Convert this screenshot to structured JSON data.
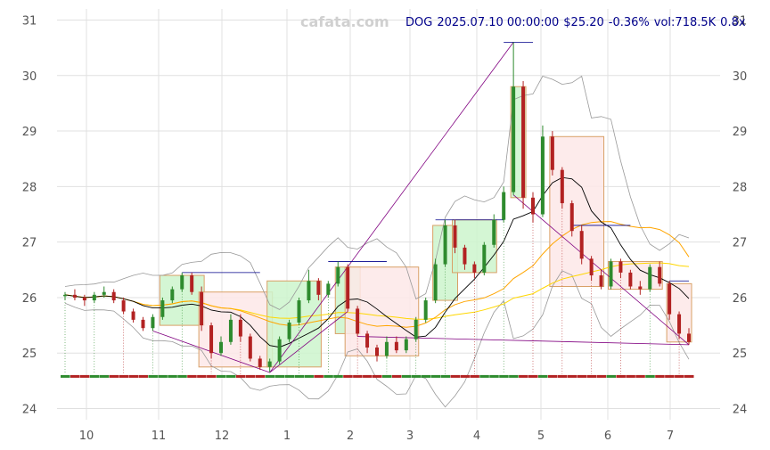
{
  "watermark": "cafata.com",
  "header": {
    "symbol": "DOG",
    "datetime": "2025.07.10 00:00:00",
    "price": "$25.20",
    "change": "-0.36%",
    "volume": "vol:718.5K",
    "ratio": "0.8x"
  },
  "colors": {
    "up": "#2e8b2e",
    "down": "#b22222",
    "up_zone_fill": "#ccf5cc",
    "down_zone_fill": "#fde8e8",
    "zone_border": "#d9a066",
    "grid": "#e0e0e0",
    "ma_short": "#000000",
    "ma_mid": "#ffa500",
    "ma_long": "#ffd700",
    "bollinger": "#999999",
    "trend": "#800080",
    "level": "#00008b"
  },
  "chart_data": {
    "type": "candlestick",
    "x_tick_labels": [
      "10",
      "11",
      "12",
      "1",
      "2",
      "3",
      "4",
      "5",
      "6",
      "7"
    ],
    "y_tick_labels": [
      "24",
      "25",
      "26",
      "27",
      "28",
      "29",
      "30",
      "31"
    ],
    "ylim": [
      23.8,
      31.2
    ],
    "grid": true,
    "series": [
      {
        "values": [
          [
            26.05,
            26.1,
            25.95,
            26.05
          ],
          [
            26.05,
            26.15,
            25.95,
            26.0
          ],
          [
            26.0,
            26.05,
            25.85,
            25.95
          ],
          [
            25.95,
            26.1,
            25.9,
            26.05
          ],
          [
            26.05,
            26.2,
            26.0,
            26.1
          ],
          [
            26.1,
            26.15,
            25.9,
            25.95
          ],
          [
            25.95,
            26.0,
            25.7,
            25.75
          ],
          [
            25.75,
            25.8,
            25.55,
            25.6
          ],
          [
            25.6,
            25.65,
            25.4,
            25.45
          ],
          [
            25.45,
            25.7,
            25.4,
            25.65
          ],
          [
            25.65,
            26.0,
            25.6,
            25.95
          ],
          [
            25.95,
            26.2,
            25.9,
            26.15
          ],
          [
            26.15,
            26.45,
            26.1,
            26.4
          ],
          [
            26.4,
            26.45,
            26.05,
            26.1
          ],
          [
            26.1,
            26.2,
            25.4,
            25.5
          ],
          [
            25.5,
            25.55,
            24.9,
            25.0
          ],
          [
            25.0,
            25.3,
            24.95,
            25.2
          ],
          [
            25.2,
            25.7,
            25.15,
            25.6
          ],
          [
            25.6,
            25.7,
            25.2,
            25.3
          ],
          [
            25.3,
            25.35,
            24.85,
            24.9
          ],
          [
            24.9,
            24.95,
            24.7,
            24.75
          ],
          [
            24.75,
            24.9,
            24.65,
            24.85
          ],
          [
            24.85,
            25.3,
            24.8,
            25.25
          ],
          [
            25.25,
            25.6,
            25.2,
            25.55
          ],
          [
            25.55,
            26.0,
            25.5,
            25.95
          ],
          [
            25.95,
            26.5,
            25.9,
            26.3
          ],
          [
            26.3,
            26.35,
            25.95,
            26.05
          ],
          [
            26.05,
            26.3,
            26.0,
            26.25
          ],
          [
            26.25,
            26.65,
            26.2,
            26.55
          ],
          [
            26.55,
            26.6,
            25.75,
            25.8
          ],
          [
            25.8,
            25.85,
            25.3,
            25.35
          ],
          [
            25.35,
            25.4,
            25.0,
            25.1
          ],
          [
            25.1,
            25.15,
            24.85,
            24.95
          ],
          [
            24.95,
            25.3,
            24.9,
            25.2
          ],
          [
            25.2,
            25.3,
            25.0,
            25.05
          ],
          [
            25.05,
            25.3,
            25.0,
            25.25
          ],
          [
            25.25,
            25.65,
            25.2,
            25.6
          ],
          [
            25.6,
            26.0,
            25.55,
            25.95
          ],
          [
            25.95,
            26.7,
            25.9,
            26.6
          ],
          [
            26.6,
            27.4,
            26.55,
            27.3
          ],
          [
            27.3,
            27.4,
            26.8,
            26.9
          ],
          [
            26.9,
            26.95,
            26.5,
            26.6
          ],
          [
            26.6,
            26.65,
            26.35,
            26.45
          ],
          [
            26.45,
            27.0,
            26.4,
            26.95
          ],
          [
            26.95,
            27.5,
            26.9,
            27.4
          ],
          [
            27.4,
            28.0,
            27.35,
            27.9
          ],
          [
            27.9,
            30.6,
            27.85,
            29.8
          ],
          [
            29.8,
            29.9,
            27.6,
            27.8
          ],
          [
            27.8,
            27.9,
            27.35,
            27.5
          ],
          [
            27.5,
            29.1,
            27.45,
            28.9
          ],
          [
            28.9,
            29.0,
            28.2,
            28.3
          ],
          [
            28.3,
            28.35,
            27.6,
            27.7
          ],
          [
            27.7,
            27.75,
            27.1,
            27.2
          ],
          [
            27.2,
            27.3,
            26.6,
            26.7
          ],
          [
            26.7,
            26.75,
            26.3,
            26.4
          ],
          [
            26.4,
            26.5,
            26.15,
            26.2
          ],
          [
            26.2,
            26.7,
            26.15,
            26.65
          ],
          [
            26.65,
            26.7,
            26.35,
            26.45
          ],
          [
            26.45,
            26.5,
            26.15,
            26.2
          ],
          [
            26.2,
            26.3,
            26.05,
            26.15
          ],
          [
            26.15,
            26.6,
            26.1,
            26.55
          ],
          [
            26.55,
            26.65,
            26.2,
            26.25
          ],
          [
            26.25,
            26.3,
            25.6,
            25.7
          ],
          [
            25.7,
            25.75,
            25.25,
            25.35
          ],
          [
            25.35,
            25.45,
            25.15,
            25.2
          ]
        ]
      }
    ]
  }
}
